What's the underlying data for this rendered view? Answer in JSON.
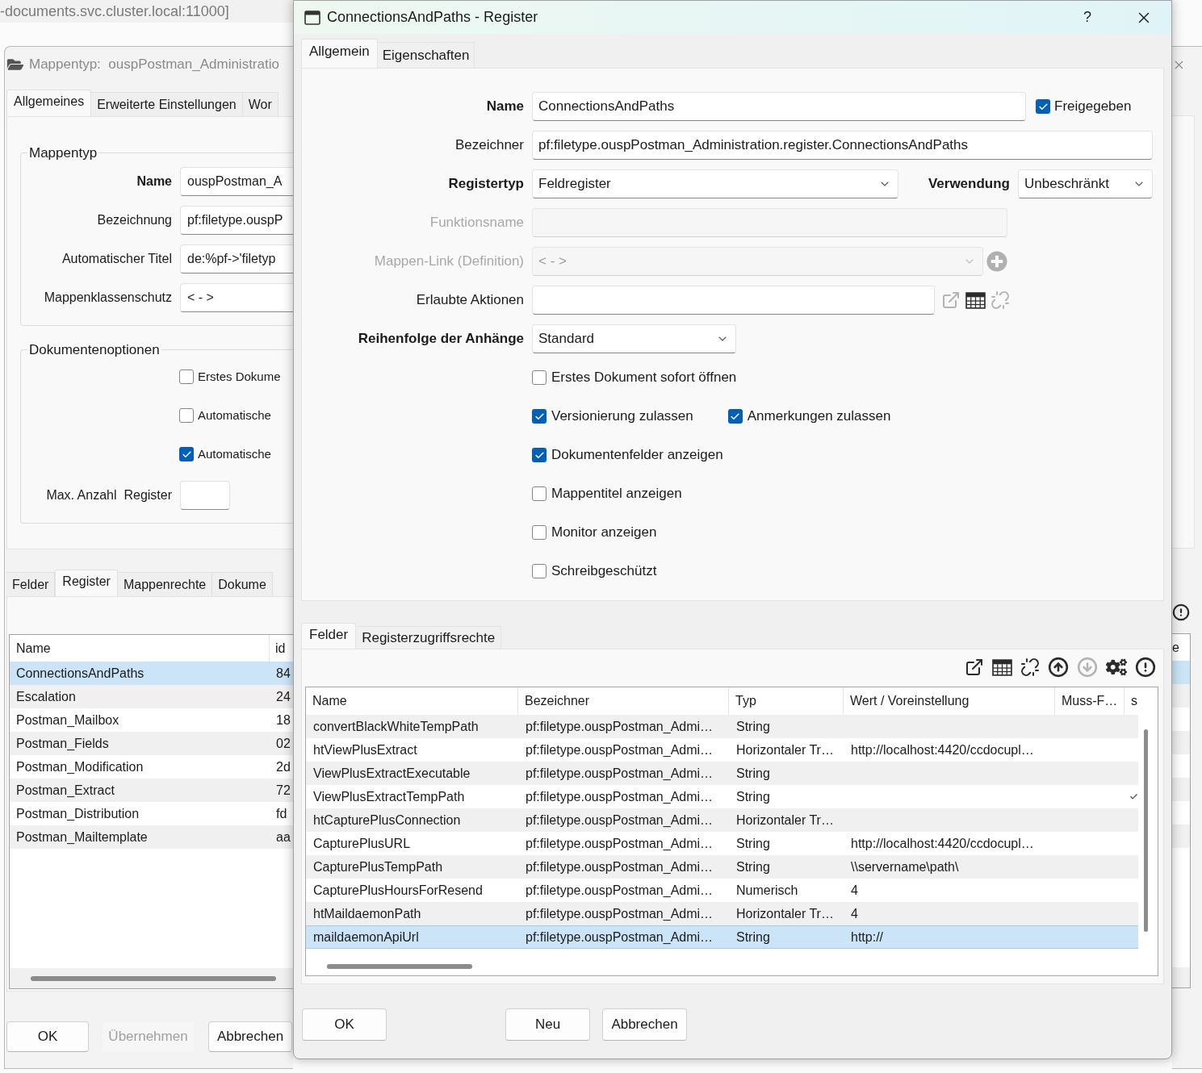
{
  "background_window": {
    "address": "-documents.svc.cluster.local:11000]",
    "title": "Mappentyp:  ouspPostman_Administratio",
    "tabs": [
      {
        "label": "Allgemeines",
        "selected": true
      },
      {
        "label": "Erweiterte Einstellungen",
        "selected": false
      },
      {
        "label": "Wor",
        "selected": false
      }
    ],
    "mappentyp": {
      "legend": "Mappentyp",
      "fields": [
        {
          "label": "Name",
          "bold": true,
          "value": "ouspPostman_A"
        },
        {
          "label": "Bezeichnung",
          "bold": false,
          "value": "pf:filetype.ouspP"
        },
        {
          "label": "Automatischer Titel",
          "bold": false,
          "value": "de:%pf->'filetyp"
        },
        {
          "label": "Mappenklassenschutz",
          "bold": false,
          "value": "< - >"
        }
      ]
    },
    "dokumentenoptionen": {
      "legend": "Dokumentenoptionen",
      "checkboxes": [
        {
          "label": "Erstes Dokume",
          "checked": false
        },
        {
          "label": "Automatische",
          "checked": false
        },
        {
          "label": "Automatische",
          "checked": true
        }
      ],
      "max_register": {
        "label": "Max. Anzahl  Register"
      }
    },
    "lower_tabs": [
      {
        "label": "Felder",
        "selected": false
      },
      {
        "label": "Register",
        "selected": true
      },
      {
        "label": "Mappenrechte",
        "selected": false
      },
      {
        "label": "Dokume",
        "selected": false
      }
    ],
    "table": {
      "columns": [
        "Name",
        "id"
      ],
      "rows": [
        {
          "name": "ConnectionsAndPaths",
          "id": "84",
          "selected": true
        },
        {
          "name": "Escalation",
          "id": "24",
          "selected": false
        },
        {
          "name": "Postman_Mailbox",
          "id": "18",
          "selected": false
        },
        {
          "name": "Postman_Fields",
          "id": "02",
          "selected": false
        },
        {
          "name": "Postman_Modification",
          "id": "2d",
          "selected": false
        },
        {
          "name": "Postman_Extract",
          "id": "72",
          "selected": false
        },
        {
          "name": "Postman_Distribution",
          "id": "fd",
          "selected": false
        },
        {
          "name": "Postman_Mailtemplate",
          "id": "aa",
          "selected": false
        }
      ]
    },
    "right_column_header": "e",
    "buttons": [
      {
        "label": "OK",
        "disabled": false
      },
      {
        "label": "Übernehmen",
        "disabled": true
      },
      {
        "label": "Abbrechen",
        "disabled": false
      }
    ]
  },
  "dialog": {
    "title": "ConnectionsAndPaths - Register",
    "help": "?",
    "tabs": [
      {
        "label": "Allgemein",
        "selected": true
      },
      {
        "label": "Eigenschaften",
        "selected": false
      }
    ],
    "name": {
      "label": "Name",
      "bold": true,
      "disabled": false,
      "value": "ConnectionsAndPaths"
    },
    "freigegeben": {
      "label": "Freigegeben",
      "checked": true
    },
    "bezeichner": {
      "label": "Bezeichner",
      "bold": false,
      "disabled": false,
      "value": "pf:filetype.ouspPostman_Administration.register.ConnectionsAndPaths"
    },
    "registertyp": {
      "label": "Registertyp",
      "bold": true,
      "disabled": false,
      "value": "Feldregister"
    },
    "verwendung": {
      "label": "Verwendung",
      "bold": true,
      "disabled": false,
      "value": "Unbeschränkt"
    },
    "funktionsname": {
      "label": "Funktionsname",
      "bold": false,
      "disabled": true
    },
    "mappen_link": {
      "label": "Mappen-Link (Definition)",
      "bold": false,
      "disabled": true,
      "value": "< - >"
    },
    "erlaubte_aktionen": {
      "label": "Erlaubte Aktionen",
      "bold": false,
      "disabled": false,
      "tools": [
        {
          "kind": "open",
          "disabled": true
        },
        {
          "kind": "table",
          "disabled": false
        },
        {
          "kind": "unlink",
          "disabled": true
        }
      ]
    },
    "reihenfolge": {
      "label": "Reihenfolge der Anhänge",
      "bold": true,
      "disabled": false,
      "value": "Standard"
    },
    "option_rows": [
      {
        "options": [
          {
            "label": "Erstes Dokument sofort öffnen",
            "checked": false
          }
        ]
      },
      {
        "options": [
          {
            "label": "Versionierung zulassen",
            "checked": true
          },
          {
            "label": "Anmerkungen zulassen",
            "checked": true
          }
        ]
      },
      {
        "options": [
          {
            "label": "Dokumentenfelder anzeigen",
            "checked": true
          }
        ]
      },
      {
        "options": [
          {
            "label": "Mappentitel anzeigen",
            "checked": false
          }
        ]
      },
      {
        "options": [
          {
            "label": "Monitor anzeigen",
            "checked": false
          }
        ]
      },
      {
        "options": [
          {
            "label": "Schreibgeschützt",
            "checked": false
          }
        ]
      }
    ],
    "lower_tabs": [
      {
        "label": "Felder",
        "selected": true
      },
      {
        "label": "Registerzugriffsrechte",
        "selected": false
      }
    ],
    "toolbar": [
      {
        "kind": "open",
        "disabled": false
      },
      {
        "kind": "table",
        "disabled": false
      },
      {
        "kind": "unlink",
        "disabled": false
      },
      {
        "kind": "up",
        "disabled": false
      },
      {
        "kind": "down",
        "disabled": true
      },
      {
        "kind": "gears",
        "disabled": false
      },
      {
        "kind": "alert",
        "disabled": false
      }
    ],
    "fields_table": {
      "columns": [
        "Name",
        "Bezeichner",
        "Typ",
        "Wert / Voreinstellung",
        "Muss-F…",
        "s"
      ],
      "rows": [
        {
          "name": "convertBlackWhiteTempPath",
          "bezeichner": "pf:filetype.ouspPostman_Admi…",
          "typ": "String",
          "column_6_checked": false,
          "selected": false
        },
        {
          "name": "htViewPlusExtract",
          "bezeichner": "pf:filetype.ouspPostman_Admi…",
          "typ": "Horizontaler Tr…",
          "wert": "http://localhost:4420/ccdocupl…",
          "column_6_checked": false,
          "selected": false
        },
        {
          "name": "ViewPlusExtractExecutable",
          "bezeichner": "pf:filetype.ouspPostman_Admi…",
          "typ": "String",
          "column_6_checked": false,
          "selected": false
        },
        {
          "name": "ViewPlusExtractTempPath",
          "bezeichner": "pf:filetype.ouspPostman_Admi…",
          "typ": "String",
          "column_6_checked": true,
          "selected": false
        },
        {
          "name": "htCapturePlusConnection",
          "bezeichner": "pf:filetype.ouspPostman_Admi…",
          "typ": "Horizontaler Tr…",
          "column_6_checked": false,
          "selected": false
        },
        {
          "name": "CapturePlusURL",
          "bezeichner": "pf:filetype.ouspPostman_Admi…",
          "typ": "String",
          "wert": "http://localhost:4420/ccdocupl…",
          "column_6_checked": false,
          "selected": false
        },
        {
          "name": "CapturePlusTempPath",
          "bezeichner": "pf:filetype.ouspPostman_Admi…",
          "typ": "String",
          "wert": "\\\\servername\\path\\",
          "column_6_checked": false,
          "selected": false
        },
        {
          "name": "CapturePlusHoursForResend",
          "bezeichner": "pf:filetype.ouspPostman_Admi…",
          "typ": "Numerisch",
          "wert": "4",
          "column_6_checked": false,
          "selected": false
        },
        {
          "name": "htMaildaemonPath",
          "bezeichner": "pf:filetype.ouspPostman_Admi…",
          "typ": "Horizontaler Tr…",
          "wert": "4",
          "column_6_checked": false,
          "selected": false
        },
        {
          "name": "maildaemonApiUrl",
          "bezeichner": "pf:filetype.ouspPostman_Admi…",
          "typ": "String",
          "wert": "http://",
          "column_6_checked": false,
          "selected": true
        }
      ]
    },
    "buttons": [
      {
        "label": "OK"
      },
      {
        "label": "Neu"
      },
      {
        "label": "Abbrechen"
      }
    ]
  }
}
